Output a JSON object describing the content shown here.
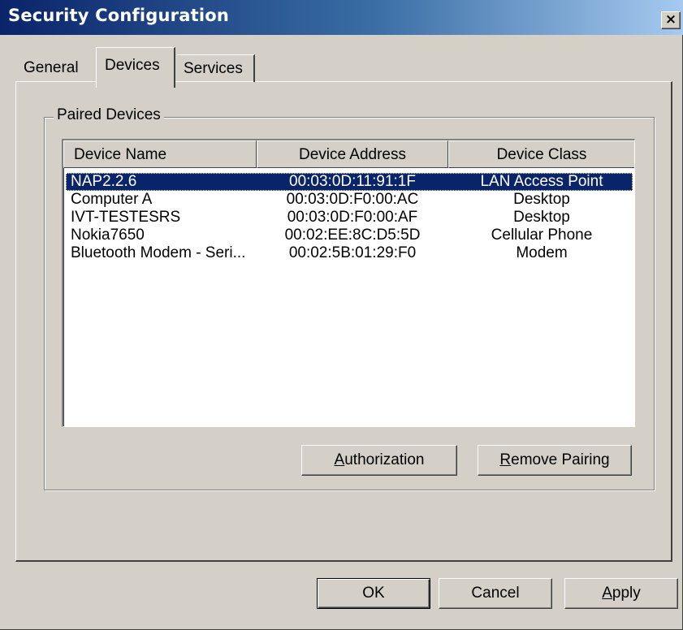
{
  "window": {
    "title": "Security Configuration",
    "close_label": "×"
  },
  "tabs": [
    {
      "label": "General",
      "active": false
    },
    {
      "label": "Devices",
      "active": true
    },
    {
      "label": "Services",
      "active": false
    }
  ],
  "paired_devices": {
    "group_label": "Paired Devices",
    "columns": [
      "Device Name",
      "Device Address",
      "Device Class"
    ],
    "rows": [
      {
        "name": "NAP2.2.6",
        "address": "00:03:0D:11:91:1F",
        "class": "LAN Access Point",
        "selected": true
      },
      {
        "name": "Computer A",
        "address": "00:03:0D:F0:00:AC",
        "class": "Desktop",
        "selected": false
      },
      {
        "name": "IVT-TESTESRS",
        "address": "00:03:0D:F0:00:AF",
        "class": "Desktop",
        "selected": false
      },
      {
        "name": "Nokia7650",
        "address": "00:02:EE:8C:D5:5D",
        "class": "Cellular Phone",
        "selected": false
      },
      {
        "name": "Bluetooth Modem - Seri...",
        "address": "00:02:5B:01:29:F0",
        "class": "Modem",
        "selected": false
      }
    ],
    "buttons": {
      "authorization": {
        "accel": "A",
        "rest": "uthorization"
      },
      "remove_pairing": {
        "accel": "R",
        "rest": "emove Pairing"
      }
    }
  },
  "dialog_buttons": {
    "ok": "OK",
    "cancel": "Cancel",
    "apply": {
      "accel": "A",
      "rest": "pply"
    }
  },
  "colors": {
    "selection": "#0a246a",
    "face": "#d4d0c8"
  }
}
